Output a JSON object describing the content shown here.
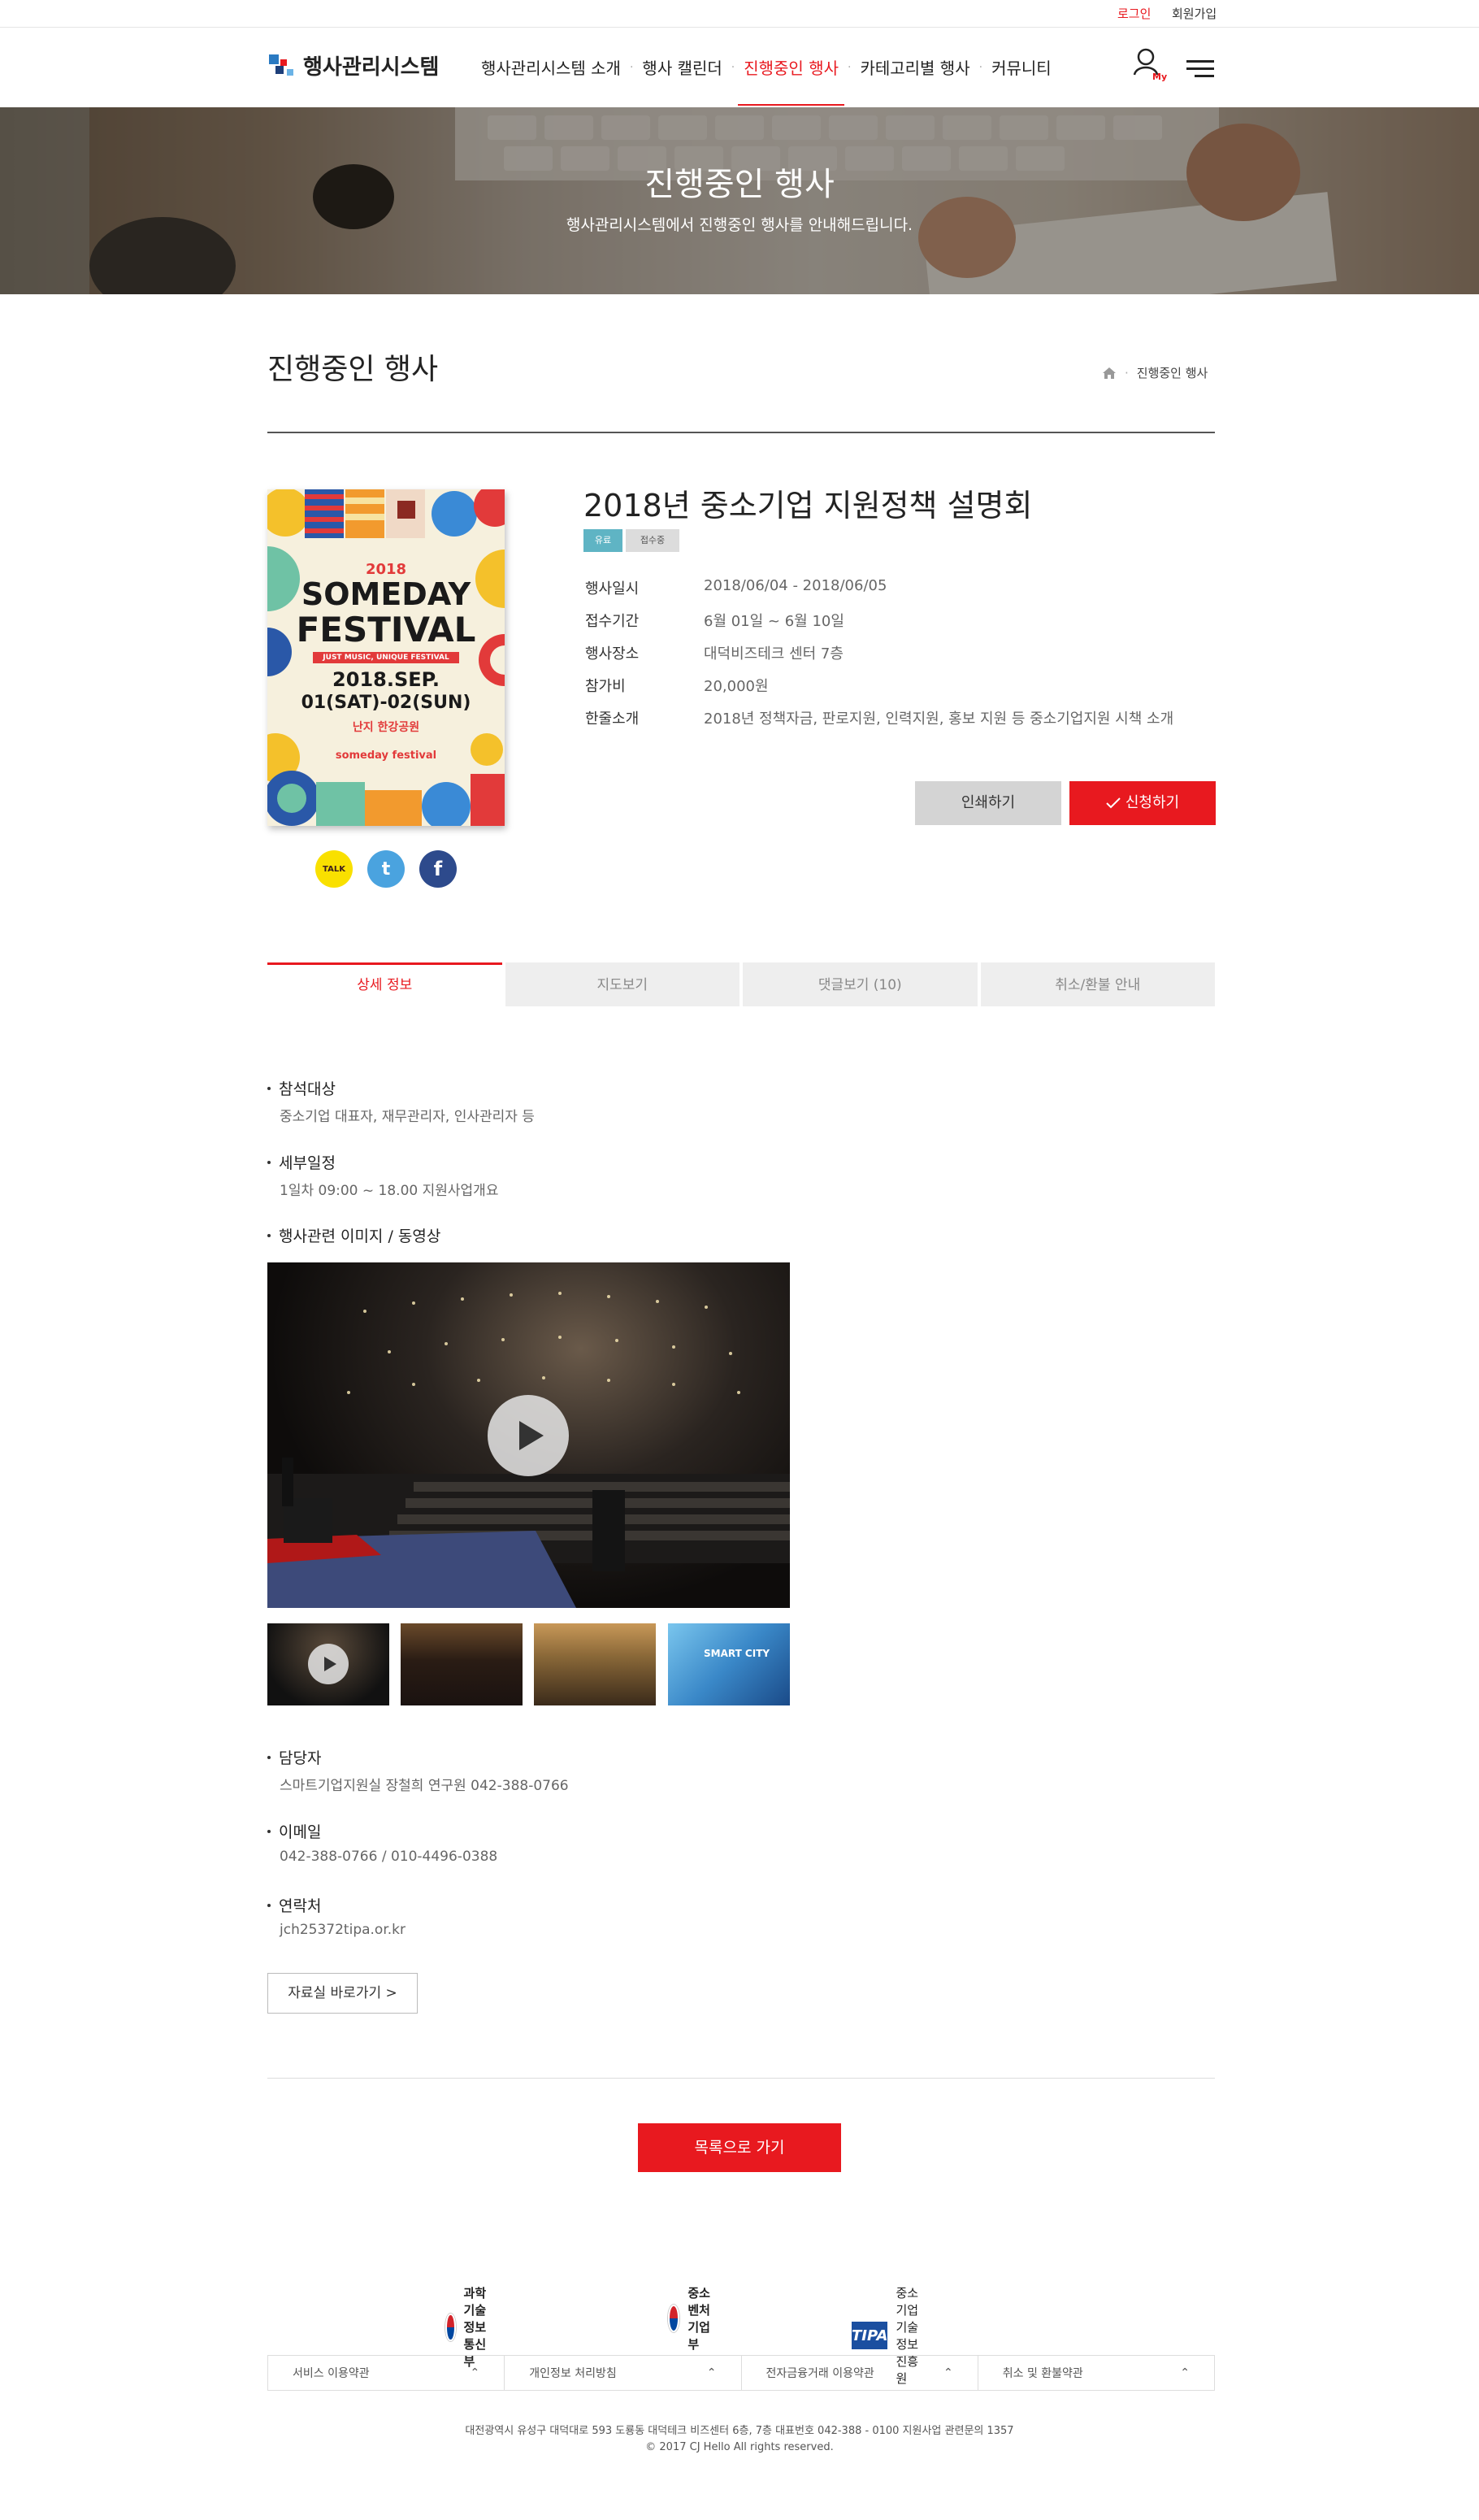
{
  "topbar": {
    "login": "로그인",
    "signup": "회원가입"
  },
  "header": {
    "logo_text": "행사관리시스템",
    "nav": [
      "행사관리시스템 소개",
      "행사 캘린더",
      "진행중인 행사",
      "카테고리별 행사",
      "커뮤니티"
    ],
    "active_index": 2,
    "my_label": "My"
  },
  "hero": {
    "title": "진행중인 행사",
    "subtitle": "행사관리시스템에서 진행중인 행사를 안내해드립니다."
  },
  "page": {
    "title": "진행중인 행사",
    "breadcrumb": "진행중인 행사"
  },
  "poster": {
    "year": "2018",
    "line1": "SOMEDAY",
    "line2": "FESTIVAL",
    "tagline": "JUST MUSIC, UNIQUE FESTIVAL",
    "date1": "2018.SEP.",
    "date2": "01(SAT)-02(SUN)",
    "place": "난지 한강공원",
    "brand": "someday festival"
  },
  "social": {
    "kakao": "TALK",
    "twitter": "t",
    "facebook": "f"
  },
  "event": {
    "title": "2018년 중소기업 지원정책 설명회",
    "badges": [
      "유료",
      "접수중"
    ],
    "info": [
      {
        "k": "행사일시",
        "v": "2018/06/04 - 2018/06/05"
      },
      {
        "k": "접수기간",
        "v": "6월 01일 ~ 6월 10일"
      },
      {
        "k": "행사장소",
        "v": "대덕비즈테크 센터 7층"
      },
      {
        "k": "참가비",
        "v": "20,000원"
      },
      {
        "k": "한줄소개",
        "v": "2018년 정책자금, 판로지원, 인력지원, 홍보 지원 등 중소기업지원 시책 소개"
      }
    ],
    "print_label": "인쇄하기",
    "apply_label": "신청하기"
  },
  "tabs": [
    "상세 정보",
    "지도보기",
    "댓글보기 (10)",
    "취소/환불 안내"
  ],
  "detail": {
    "target_title": "참석대상",
    "target_text": "중소기업 대표자, 재무관리자, 인사관리자 등",
    "schedule_title": "세부일정",
    "schedule_text": "1일차 09:00 ~ 18.00  지원사업개요",
    "media_title": "행사관련 이미지 / 동영상",
    "thumb4_text": "SMART CITY",
    "manager_title": "담당자",
    "manager_text": "스마트기업지원실 장철희 연구원  042-388-0766",
    "email_title": "이메일",
    "email_text": "042-388-0766 / 010-4496-0388",
    "contact_title": "연락처",
    "contact_text": "jch25372tipa.or.kr",
    "link_label": "자료실 바로가기 >",
    "list_label": "목록으로 가기"
  },
  "footer": {
    "orgs": [
      "과학기술정보통신부",
      "중소벤처기업부",
      "중소기업기술정보진흥원"
    ],
    "tipa_mark": "TIPA",
    "menu": [
      "서비스 이용약관",
      "개인정보 처리방침",
      "전자금융거래 이용약관",
      "취소 및 환불약관"
    ],
    "address": "대전광역시 유성구 대덕대로 593 도룡동 대덕테크 비즈센터 6층, 7층  대표번호 042-388 - 0100  지원사업 관련문의 1357",
    "copyright": "© 2017 CJ Hello All rights reserved."
  },
  "colors": {
    "accent": "#e8191f",
    "badge_paid": "#5fb4c4",
    "badge_status": "#dcdcdc"
  }
}
